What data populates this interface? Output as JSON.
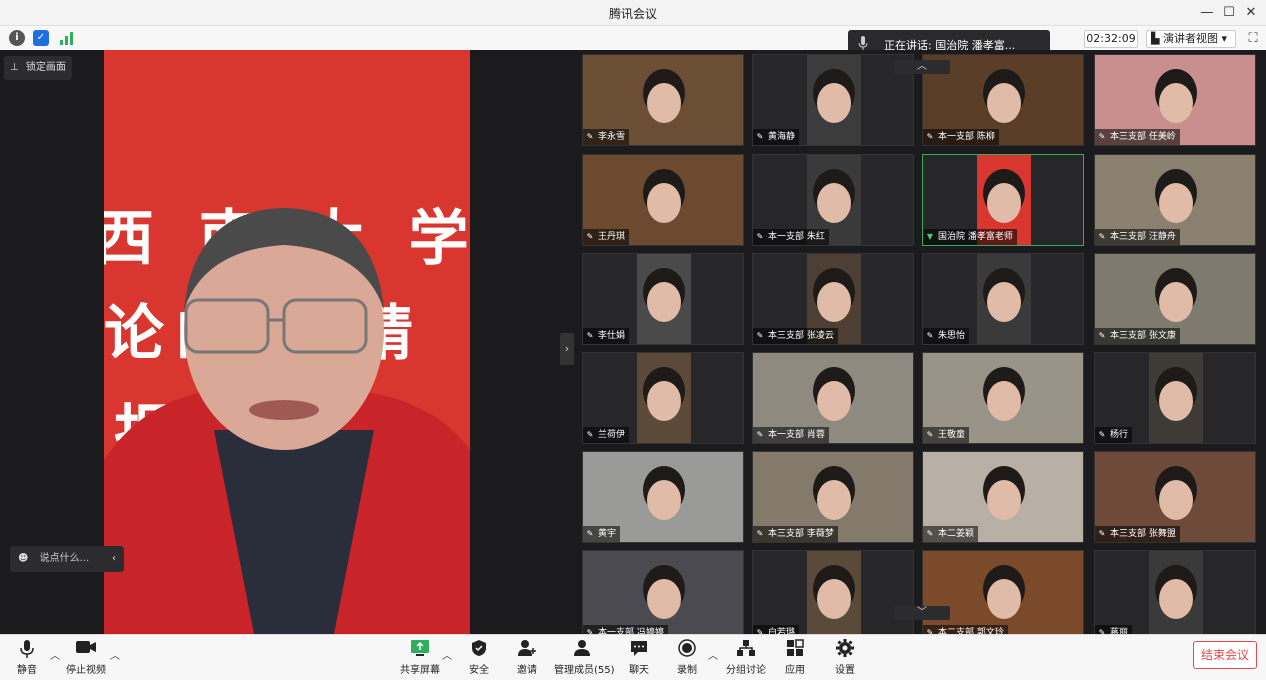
{
  "window": {
    "title": "腾讯会议"
  },
  "speaking": {
    "text": "正在讲话: 国治院 潘孝富..."
  },
  "timer": "02:32:09",
  "view_selector": "演讲者视图",
  "lock_label": "锁定画面",
  "chat_placeholder": "说点什么...",
  "main_speaker": {
    "bg_lines": [
      "西 南 大 学",
      "论的 大精",
      "报  会"
    ]
  },
  "participants": [
    {
      "name": "李永雪"
    },
    {
      "name": "黄海静"
    },
    {
      "name": "本一支部 陈柳"
    },
    {
      "name": "本三支部 任美岭"
    },
    {
      "name": "王丹琪"
    },
    {
      "name": "本一支部 朱红"
    },
    {
      "name": "国治院 潘孝富老师",
      "active": true
    },
    {
      "name": "本三支部 汪静舟"
    },
    {
      "name": "李仕娟"
    },
    {
      "name": "本三支部 张凌云"
    },
    {
      "name": "朱思怡"
    },
    {
      "name": "本三支部 张文康"
    },
    {
      "name": "兰荷伊"
    },
    {
      "name": "本一支部 肖蓉"
    },
    {
      "name": "王敬童"
    },
    {
      "name": "杨行"
    },
    {
      "name": "黄宇"
    },
    {
      "name": "本三支部 李薇梦"
    },
    {
      "name": "本二姜颖"
    },
    {
      "name": "本三支部 张舞盟"
    },
    {
      "name": "本一支部 冯婷婷"
    },
    {
      "name": "白若璐"
    },
    {
      "name": "本二支部 郭文玲"
    },
    {
      "name": "蒋丽"
    }
  ],
  "toolbar": {
    "mute": "静音",
    "stop_video": "停止视频",
    "share_screen": "共享屏幕",
    "security": "安全",
    "invite": "邀请",
    "manage_members": "管理成员(55)",
    "chat": "聊天",
    "record": "录制",
    "breakout": "分组讨论",
    "apps": "应用",
    "settings": "设置",
    "end_meeting": "结束会议"
  },
  "colors": {
    "accent_green": "#2fae5b",
    "end_red": "#e64a4a",
    "banner_red": "#d8362e"
  }
}
